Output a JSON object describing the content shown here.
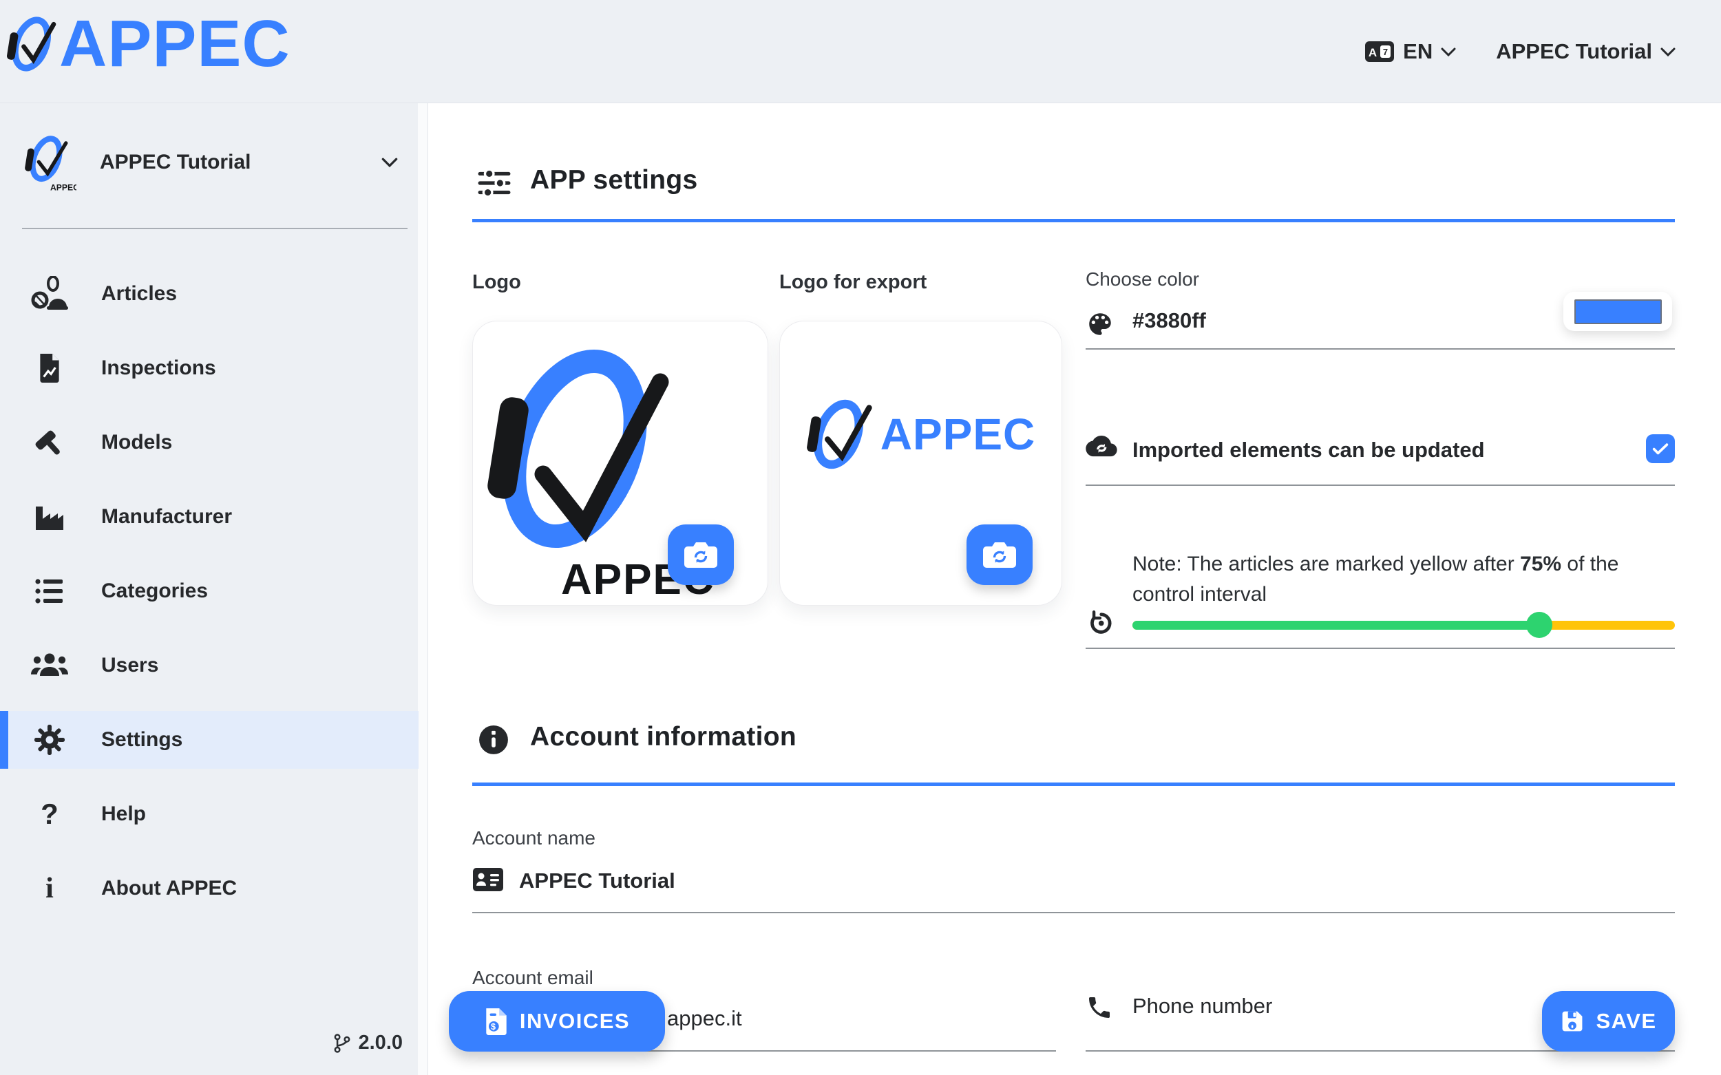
{
  "brand": {
    "name": "APPEC",
    "color": "#3880ff"
  },
  "topbar": {
    "language": "EN",
    "account": "APPEC Tutorial"
  },
  "sidebar": {
    "account": "APPEC Tutorial",
    "items": [
      {
        "label": "Articles"
      },
      {
        "label": "Inspections"
      },
      {
        "label": "Models"
      },
      {
        "label": "Manufacturer"
      },
      {
        "label": "Categories"
      },
      {
        "label": "Users"
      },
      {
        "label": "Settings"
      },
      {
        "label": "Help"
      },
      {
        "label": "About APPEC"
      }
    ],
    "active_item": "Settings",
    "version": "2.0.0"
  },
  "main": {
    "app_settings": {
      "title": "APP settings",
      "logo_label": "Logo",
      "logo_export_label": "Logo for export",
      "choose_color_label": "Choose color",
      "color_value": "#3880ff",
      "imported_label": "Imported elements can be updated",
      "imported_checked": true,
      "note_prefix": "Note: The articles are marked yellow after ",
      "note_bold": "75%",
      "note_suffix": " of the control interval",
      "slider_percent": 75
    },
    "account_information": {
      "title": "Account information",
      "account_name_label": "Account name",
      "account_name_value": "APPEC Tutorial",
      "account_email_label": "Account email",
      "account_email_visible": "appec.it",
      "phone_label": "Phone number"
    },
    "buttons": {
      "invoices": "INVOICES",
      "save": "SAVE"
    }
  },
  "colors": {
    "primary": "#3880ff",
    "slider_green": "#2dd36f",
    "slider_yellow": "#ffc409",
    "sidebar_bg": "#edf0f4",
    "active_item_bg": "#e3ecfb",
    "underline": "#8f9499"
  }
}
